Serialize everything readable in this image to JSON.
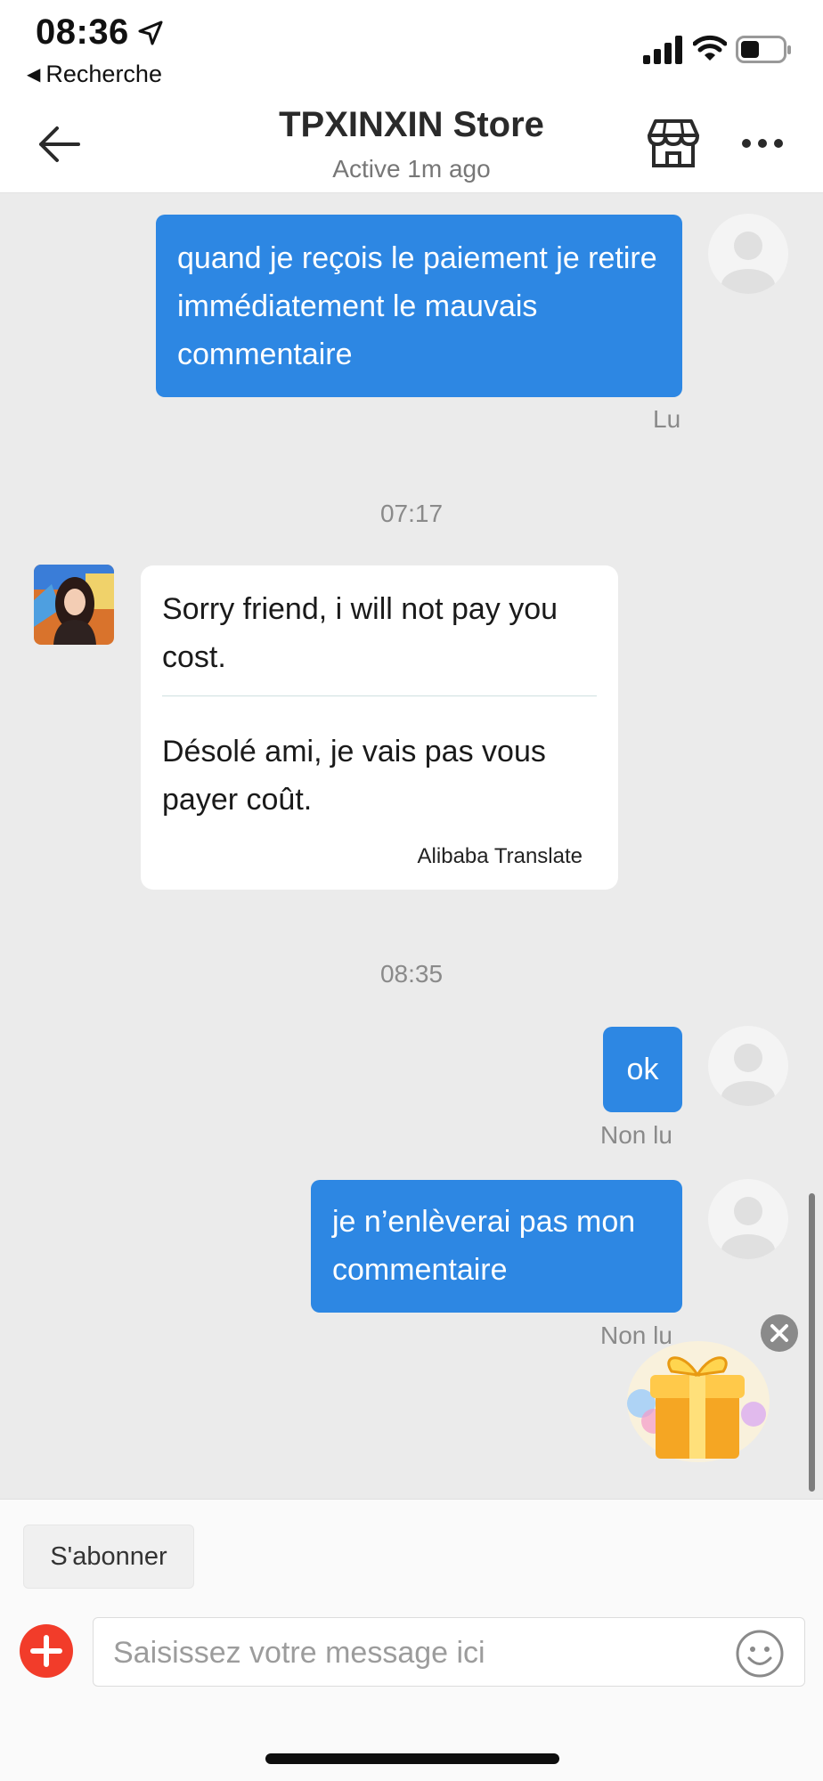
{
  "status_bar": {
    "time": "08:36",
    "back_app": "Recherche"
  },
  "header": {
    "title": "TPXINXIN Store",
    "subtitle": "Active 1m ago"
  },
  "messages": {
    "m1_text": "quand je reçois le paiement je retire immédiatement le mauvais commentaire",
    "m1_status": "Lu",
    "ts1": "07:17",
    "m2_original": "Sorry friend, i will not pay you cost.",
    "m2_translation": "Désolé ami, je vais pas vous payer coût.",
    "m2_translate_label": "Alibaba Translate",
    "ts2": "08:35",
    "m3_text": "ok",
    "m3_status": "Non lu",
    "m4_text": "je n’enlèverai pas mon commentaire",
    "m4_status": "Non lu"
  },
  "bottom": {
    "subscribe_label": "S'abonner",
    "input_placeholder": "Saisissez votre message ici"
  },
  "colors": {
    "outgoing_bubble": "#2d87e3",
    "add_button": "#f23c2a",
    "background": "#ebebeb"
  },
  "icons": [
    "location-arrow-icon",
    "signal-icon",
    "wifi-icon",
    "battery-icon",
    "back-arrow-icon",
    "store-icon",
    "more-icon",
    "close-icon",
    "gift-icon",
    "plus-icon",
    "emoji-icon"
  ]
}
